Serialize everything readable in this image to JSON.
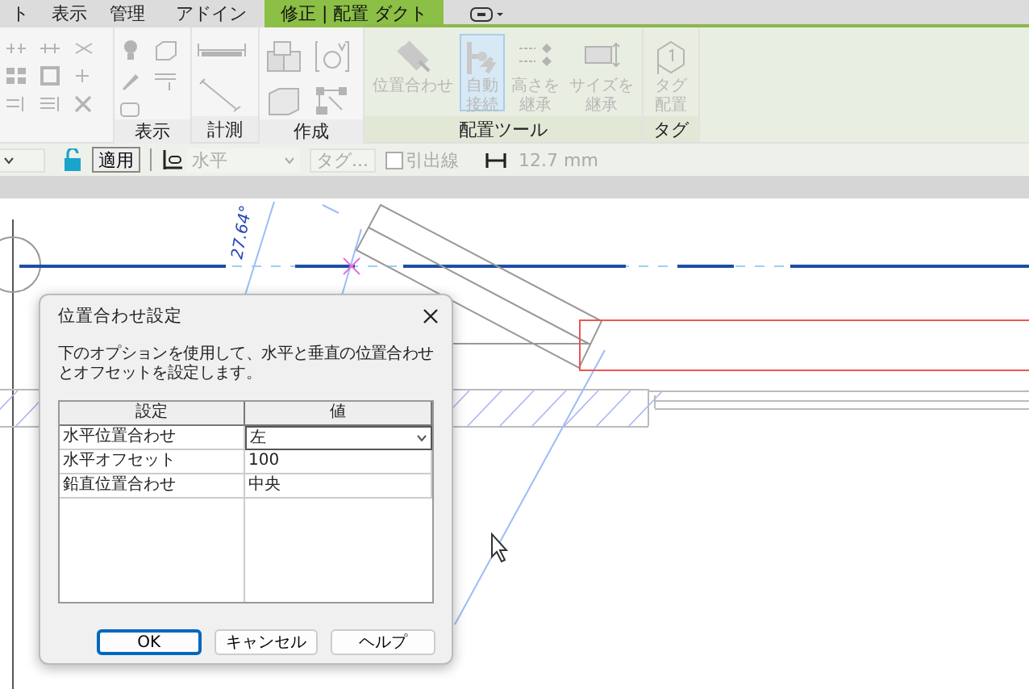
{
  "ribbon_tabs": [
    {
      "label": "ト",
      "selected": false
    },
    {
      "label": "表示",
      "selected": false
    },
    {
      "label": "管理",
      "selected": false
    },
    {
      "label": "アドイン",
      "selected": false
    },
    {
      "label": "修正 | 配置 ダクト",
      "selected": true
    }
  ],
  "ribbon_panels": [
    {
      "label": "表示"
    },
    {
      "label": "計測"
    },
    {
      "label": "作成"
    },
    {
      "label": "配置ツール",
      "tools": [
        {
          "label": "位置合わせ",
          "disabled": true,
          "selected": false
        },
        {
          "label": "自動接続",
          "disabled": true,
          "selected": true
        },
        {
          "label": "高さを継承",
          "disabled": true,
          "selected": false
        },
        {
          "label": "サイズを継承",
          "disabled": true,
          "selected": false
        }
      ]
    },
    {
      "label": "タグ",
      "tools": [
        {
          "label": "タグ配置",
          "disabled": true,
          "selected": false
        }
      ]
    }
  ],
  "options_bar": {
    "apply_button": "適用",
    "justification": {
      "value": "水平",
      "disabled": true
    },
    "tag_button": {
      "label": "タグ...",
      "disabled": true
    },
    "leader": {
      "label": "引出線",
      "checked": false,
      "disabled": true
    },
    "offset": {
      "value": "12.7 mm",
      "disabled": true
    }
  },
  "canvas": {
    "angle_label": "27.64°"
  },
  "dialog": {
    "title": "位置合わせ設定",
    "description": "下のオプションを使用して、水平と垂直の位置合わせとオフセットを設定します。",
    "columns": [
      "設定",
      "値"
    ],
    "rows": [
      {
        "setting": "水平位置合わせ",
        "value": "左",
        "kind": "dropdown"
      },
      {
        "setting": "水平オフセット",
        "value": "100",
        "kind": "text"
      },
      {
        "setting": "鉛直位置合わせ",
        "value": "中央",
        "kind": "text"
      }
    ],
    "buttons": [
      {
        "label": "OK",
        "default": true
      },
      {
        "label": "キャンセル",
        "default": false
      },
      {
        "label": "ヘルプ",
        "default": false
      }
    ]
  }
}
